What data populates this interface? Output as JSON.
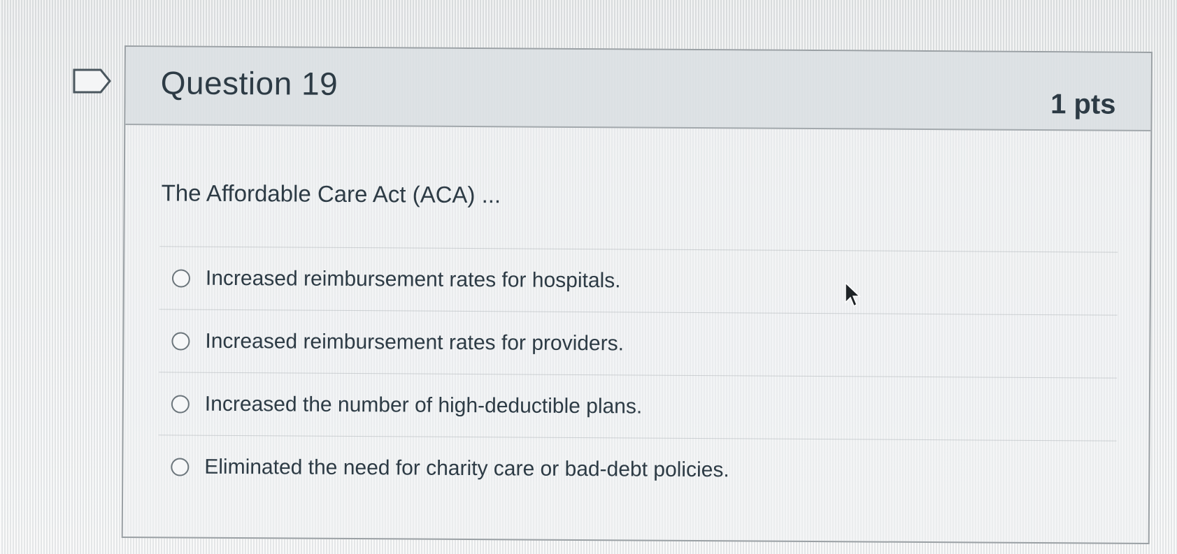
{
  "question": {
    "title": "Question 19",
    "points": "1 pts",
    "text": "The Affordable Care Act (ACA) ...",
    "answers": [
      {
        "label": "Increased reimbursement rates for hospitals."
      },
      {
        "label": "Increased reimbursement rates for providers."
      },
      {
        "label": "Increased the number of high-deductible plans."
      },
      {
        "label": "Eliminated the need for charity care or bad-debt policies."
      }
    ]
  },
  "icons": {
    "flag": "flag-outline-icon",
    "cursor": "mouse-pointer-icon"
  },
  "colors": {
    "text": "#2d3b45",
    "header_bg": "#d7dce0",
    "border": "#9aa0a4"
  }
}
